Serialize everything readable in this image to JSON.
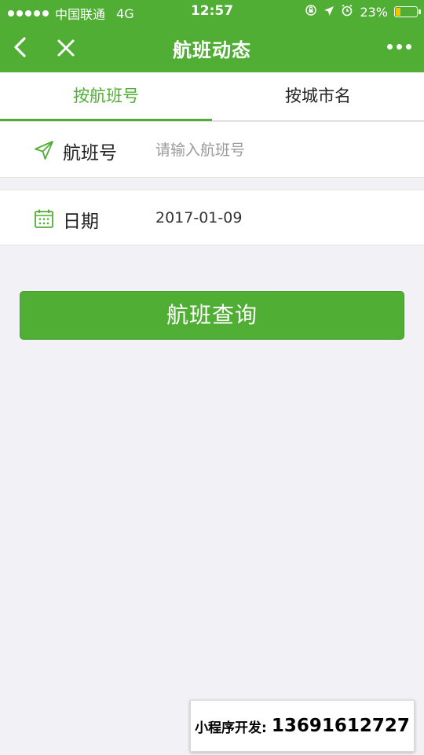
{
  "status_bar": {
    "carrier": "中国联通",
    "network": "4G",
    "time": "12:57",
    "battery": "23%",
    "battery_level": 0.23
  },
  "nav": {
    "title": "航班动态"
  },
  "tabs": [
    {
      "label": "按航班号",
      "active": true
    },
    {
      "label": "按城市名",
      "active": false
    }
  ],
  "form": {
    "flight": {
      "label": "航班号",
      "placeholder": "请输入航班号",
      "value": ""
    },
    "date": {
      "label": "日期",
      "value": "2017-01-09"
    }
  },
  "submit_label": "航班查询",
  "watermark": {
    "key": "小程序开发:",
    "value": "13691612727"
  },
  "colors": {
    "accent": "#4fae33",
    "background": "#f2f2f6",
    "battery": "#f5c400"
  }
}
